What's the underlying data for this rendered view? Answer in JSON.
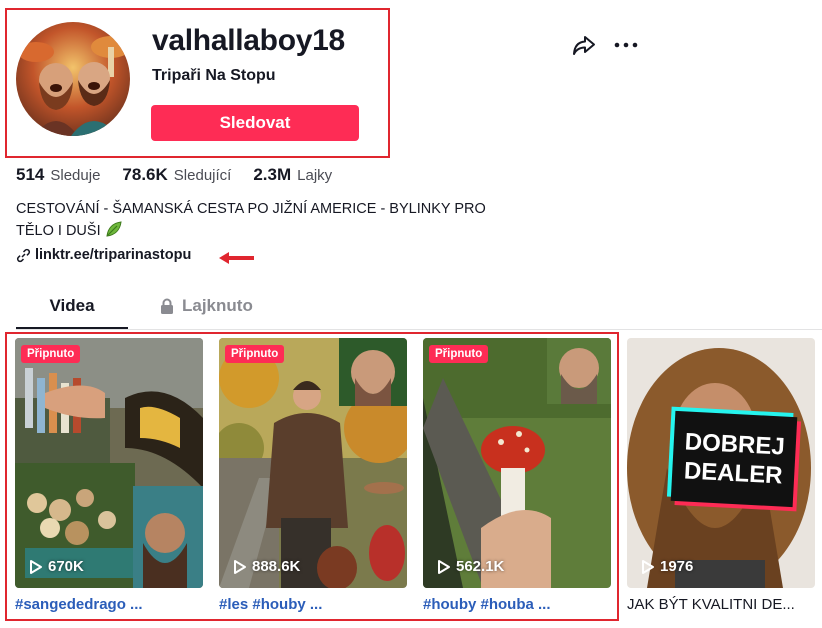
{
  "profile": {
    "username": "valhallaboy18",
    "nickname": "Tripaři Na Stopu",
    "follow_label": "Sledovat",
    "stats": [
      {
        "value": "514",
        "label": "Sleduje"
      },
      {
        "value": "78.6K",
        "label": "Sledující"
      },
      {
        "value": "2.3M",
        "label": "Lajky"
      }
    ],
    "bio_line1": "CESTOVÁNÍ - ŠAMANSKÁ CESTA PO JIŽNÍ AMERICE - BYLINKY PRO",
    "bio_line2": "TĚLO I DUŠI",
    "link": "linktr.ee/triparinastopu"
  },
  "actions": {
    "share_icon": "share-icon",
    "more_icon": "more-icon"
  },
  "tabs": [
    {
      "label": "Videa",
      "active": true
    },
    {
      "label": "Lajknuto",
      "locked": true
    }
  ],
  "videos": [
    {
      "pinned": "Připnuto",
      "views": "670K",
      "caption": "#sangededrago ..."
    },
    {
      "pinned": "Připnuto",
      "views": "888.6K",
      "caption": "#les #houby ..."
    },
    {
      "pinned": "Připnuto",
      "views": "562.1K",
      "caption": "#houby #houba ..."
    },
    {
      "pinned": "",
      "views": "1976",
      "caption": "JAK BÝT KVALITNI DE...",
      "overlay_line1": "DOBREJ",
      "overlay_line2": "DEALER"
    }
  ],
  "colors": {
    "accent": "#fe2c55",
    "annotation_red": "#e0262f",
    "hashtag": "#2b5db9"
  }
}
